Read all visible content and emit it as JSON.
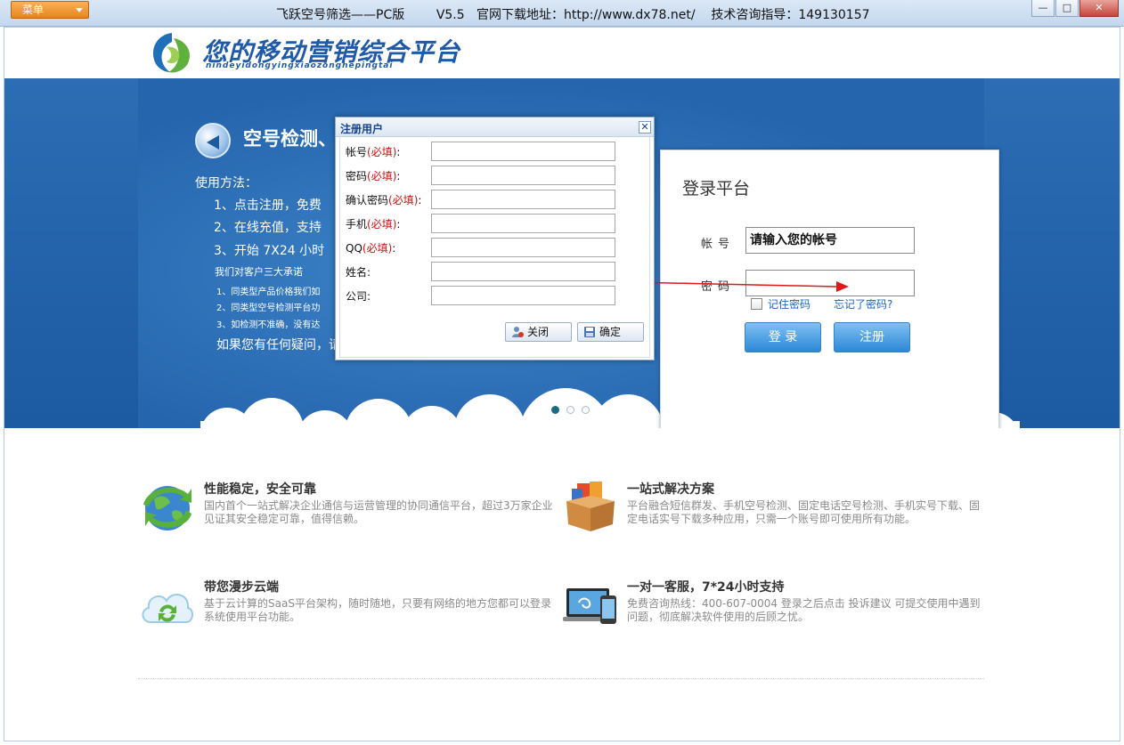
{
  "titlebar": {
    "menu_label": "菜单",
    "title": "飞跃空号筛选——PC版        V5.5   官网下载地址：http://www.dx78.net/    技术咨询指导：149130157",
    "minimize": "—",
    "maximize": "□",
    "close": "✕"
  },
  "header": {
    "logo_text": "您的移动营销综合平台",
    "logo_sub": "nindeyidongyingxiaozonghepingtai"
  },
  "banner": {
    "heading": "空号检测、",
    "usage_title": "使用方法：",
    "steps": [
      "1、点击注册，免费",
      "2、在线充值，支持",
      "3、开始 7X24 小时"
    ],
    "promise_title": "我们对客户三大承诺",
    "promises": [
      "1、同类型产品价格我们如",
      "2、同类型空号检测平台功",
      "3、如检测不准确，没有达"
    ],
    "contact": "如果您有任何疑问，请"
  },
  "login": {
    "title": "登录平台",
    "account_label": "帐号",
    "account_value": "请输入您的帐号",
    "password_label": "密码",
    "password_value": "",
    "remember_label": "记住密码",
    "forgot_label": "忘记了密码?",
    "login_button": "登 录",
    "register_button": "注册"
  },
  "register_dialog": {
    "title": "注册用户",
    "close": "✕",
    "required_mark": "(必填)",
    "fields": [
      {
        "label": "帐号",
        "required": true
      },
      {
        "label": "密码",
        "required": true
      },
      {
        "label": "确认密码",
        "required": true
      },
      {
        "label": "手机",
        "required": true
      },
      {
        "label": "QQ",
        "required": true
      },
      {
        "label": "姓名",
        "required": false
      },
      {
        "label": "公司",
        "required": false
      }
    ],
    "close_button": "关闭",
    "confirm_button": "确定"
  },
  "features": [
    {
      "title": "性能稳定，安全可靠",
      "desc": "国内首个一站式解决企业通信与运营管理的协同通信平台，超过3万家企业见证其安全稳定可靠，值得信赖。",
      "icon": "globe-icon"
    },
    {
      "title": "一站式解决方案",
      "desc": "平台融合短信群发、手机空号检测、固定电话空号检测、手机实号下载、固定电话实号下载多种应用，只需一个账号即可使用所有功能。",
      "icon": "box-icon"
    },
    {
      "title": "带您漫步云端",
      "desc": "基于云计算的SaaS平台架构，随时随地，只要有网络的地方您都可以登录系统使用平台功能。",
      "icon": "cloud-icon"
    },
    {
      "title": "一对一客服，7*24小时支持",
      "desc": "免费咨询热线：400-607-0004 登录之后点击 投诉建议 可提交使用中遇到问题，彻底解决软件使用的后顾之忧。",
      "icon": "devices-icon"
    }
  ],
  "colors": {
    "banner_blue": "#1c5aa1",
    "button_blue": "#2b88d6",
    "link_blue": "#1a64c2",
    "required_red": "#d01010",
    "arrow_red": "#e01818"
  }
}
